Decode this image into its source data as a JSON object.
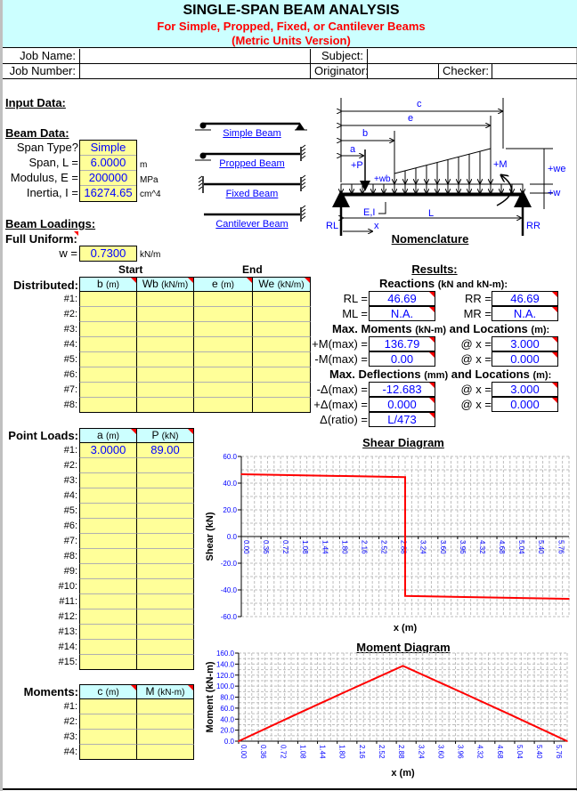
{
  "header": {
    "title": "SINGLE-SPAN BEAM ANALYSIS",
    "subtitle": "For Simple, Propped, Fixed, or Cantilever Beams",
    "version": "(Metric Units Version)"
  },
  "job": {
    "job_name_label": "Job Name:",
    "job_name": "",
    "subject_label": "Subject:",
    "subject": "",
    "job_number_label": "Job Number:",
    "job_number": "",
    "originator_label": "Originator:",
    "originator": "",
    "checker_label": "Checker:",
    "checker": ""
  },
  "input": {
    "heading": "Input Data:",
    "beam_heading": "Beam Data:",
    "span_type_label": "Span Type?",
    "span_type": "Simple",
    "span_label": "Span, L =",
    "span": "6.0000",
    "span_unit": "m",
    "modulus_label": "Modulus, E =",
    "modulus": "200000",
    "modulus_unit": "MPa",
    "inertia_label": "Inertia, I =",
    "inertia": "16274.65",
    "inertia_unit": "cm^4",
    "loadings_heading": "Beam Loadings:",
    "full_uniform_label": "Full Uniform:",
    "w_label": "w =",
    "w": "0.7300",
    "w_unit": "kN/m"
  },
  "beam_types": [
    "Simple Beam",
    "Propped Beam",
    "Fixed Beam",
    "Cantilever Beam"
  ],
  "distributed": {
    "label": "Distributed:",
    "start_label": "Start",
    "end_label": "End",
    "columns": [
      {
        "name": "b",
        "unit": "(m)"
      },
      {
        "name": "Wb",
        "unit": "(kN/m)"
      },
      {
        "name": "e",
        "unit": "(m)"
      },
      {
        "name": "We",
        "unit": "(kN/m)"
      }
    ],
    "rows": [
      [
        "#1:",
        "",
        "",
        "",
        ""
      ],
      [
        "#2:",
        "",
        "",
        "",
        ""
      ],
      [
        "#3:",
        "",
        "",
        "",
        ""
      ],
      [
        "#4:",
        "",
        "",
        "",
        ""
      ],
      [
        "#5:",
        "",
        "",
        "",
        ""
      ],
      [
        "#6:",
        "",
        "",
        "",
        ""
      ],
      [
        "#7:",
        "",
        "",
        "",
        ""
      ],
      [
        "#8:",
        "",
        "",
        "",
        ""
      ]
    ]
  },
  "point_loads": {
    "label": "Point Loads:",
    "columns": [
      {
        "name": "a",
        "unit": "(m)"
      },
      {
        "name": "P",
        "unit": "(kN)"
      }
    ],
    "rows": [
      [
        "#1:",
        "3.0000",
        "89.00"
      ],
      [
        "#2:",
        "",
        ""
      ],
      [
        "#3:",
        "",
        ""
      ],
      [
        "#4:",
        "",
        ""
      ],
      [
        "#5:",
        "",
        ""
      ],
      [
        "#6:",
        "",
        ""
      ],
      [
        "#7:",
        "",
        ""
      ],
      [
        "#8:",
        "",
        ""
      ],
      [
        "#9:",
        "",
        ""
      ],
      [
        "#10:",
        "",
        ""
      ],
      [
        "#11:",
        "",
        ""
      ],
      [
        "#12:",
        "",
        ""
      ],
      [
        "#13:",
        "",
        ""
      ],
      [
        "#14:",
        "",
        ""
      ],
      [
        "#15:",
        "",
        ""
      ]
    ]
  },
  "moments": {
    "label": "Moments:",
    "columns": [
      {
        "name": "c",
        "unit": "(m)"
      },
      {
        "name": "M",
        "unit": "(kN-m)"
      }
    ],
    "rows": [
      [
        "#1:",
        "",
        ""
      ],
      [
        "#2:",
        "",
        ""
      ],
      [
        "#3:",
        "",
        ""
      ],
      [
        "#4:",
        "",
        ""
      ]
    ]
  },
  "nomenclature": {
    "title": "Nomenclature",
    "c": "c",
    "e": "e",
    "b": "b",
    "a": "a",
    "P": "+P",
    "wb": "+wb",
    "M": "+M",
    "we": "+we",
    "w": "+w",
    "EI": "E,I",
    "L": "L",
    "RL": "RL",
    "RR": "RR",
    "x": "x"
  },
  "results": {
    "heading": "Results:",
    "reactions_heading": "Reactions",
    "reactions_units": "(kN and kN-m):",
    "RL_label": "RL =",
    "RL": "46.69",
    "RR_label": "RR =",
    "RR": "46.69",
    "ML_label": "ML =",
    "ML": "N.A.",
    "MR_label": "MR =",
    "MR": "N.A.",
    "moments_heading": "Max. Moments",
    "moments_units1": "(kN-m)",
    "moments_and": "and Locations",
    "moments_units2": "(m):",
    "pos_M_label": "+M(max) =",
    "pos_M": "136.79",
    "pos_M_x_label": "@ x =",
    "pos_M_x": "3.000",
    "neg_M_label": "-M(max) =",
    "neg_M": "0.00",
    "neg_M_x_label": "@ x =",
    "neg_M_x": "0.000",
    "defl_heading": "Max. Deflections",
    "defl_units1": "(mm)",
    "defl_and": "and Locations",
    "defl_units2": "(m):",
    "neg_d_label": "-Δ(max) =",
    "neg_d": "-12.683",
    "neg_d_x_label": "@ x =",
    "neg_d_x": "3.000",
    "pos_d_label": "+Δ(max) =",
    "pos_d": "0.000",
    "pos_d_x_label": "@ x =",
    "pos_d_x": "0.000",
    "ratio_label": "Δ(ratio) =",
    "ratio": "L/473"
  },
  "colors": {
    "input_fill": "#ffff99",
    "header_fill": "#ccffff",
    "value_text": "#0000ff",
    "title_red": "#ff0000",
    "series": "#ff0000"
  },
  "chart_data": [
    {
      "type": "line",
      "title": "Shear Diagram",
      "xlabel": "x (m)",
      "ylabel": "Shear (kN)",
      "xlim": [
        0,
        6
      ],
      "ylim": [
        -60,
        60
      ],
      "grid": true,
      "xticks": [
        "0.00",
        "0.36",
        "0.72",
        "1.08",
        "1.44",
        "1.80",
        "2.16",
        "2.52",
        "2.88",
        "3.24",
        "3.60",
        "3.96",
        "4.32",
        "4.68",
        "5.04",
        "5.40",
        "5.76"
      ],
      "yticks": [
        "-60.0",
        "-40.0",
        "-20.0",
        "0.0",
        "20.0",
        "40.0",
        "60.0"
      ],
      "series": [
        {
          "x": [
            0,
            3,
            3,
            6
          ],
          "y": [
            46.69,
            44.5,
            -44.5,
            -46.69
          ]
        }
      ]
    },
    {
      "type": "line",
      "title": "Moment Diagram",
      "xlabel": "x (m)",
      "ylabel": "Moment (kN-m)",
      "xlim": [
        0,
        6
      ],
      "ylim": [
        0,
        160
      ],
      "grid": true,
      "xticks": [
        "0.00",
        "0.36",
        "0.72",
        "1.08",
        "1.44",
        "1.80",
        "2.16",
        "2.52",
        "2.88",
        "3.24",
        "3.60",
        "3.96",
        "4.32",
        "4.68",
        "5.04",
        "5.40",
        "5.76"
      ],
      "yticks": [
        "0.0",
        "20.0",
        "40.0",
        "60.0",
        "80.0",
        "100.0",
        "120.0",
        "140.0",
        "160.0"
      ],
      "series": [
        {
          "x": [
            0,
            1,
            2,
            3,
            4,
            5,
            6
          ],
          "y": [
            0,
            46.33,
            91.92,
            136.79,
            91.92,
            46.33,
            0
          ]
        }
      ]
    }
  ]
}
